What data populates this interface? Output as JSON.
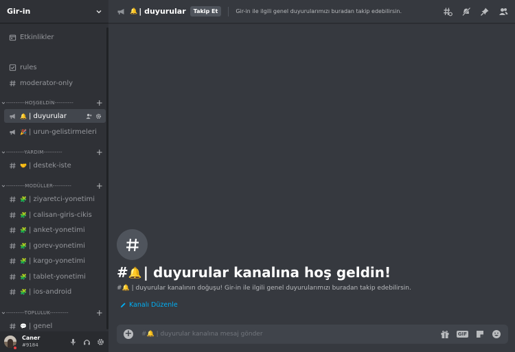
{
  "server": {
    "name": "Gir-in"
  },
  "sidebar": {
    "events_label": "Etkinlikler",
    "items_top": [
      {
        "label": "rules",
        "icon": "rules-icon"
      },
      {
        "label": "moderator-only",
        "icon": "hash-icon"
      }
    ],
    "categories": [
      {
        "label": "----------HOŞGELDİN----------",
        "channels": [
          {
            "emoji": "🔔",
            "label": "| duyurular",
            "icon": "announcement-icon",
            "active": true
          },
          {
            "emoji": "🎉",
            "label": "| urun-gelistirmeleri",
            "icon": "announcement-icon",
            "active": false
          }
        ]
      },
      {
        "label": "----------YARDIM----------",
        "channels": [
          {
            "emoji": "🤝",
            "label": "| destek-iste",
            "icon": "hash-icon"
          }
        ]
      },
      {
        "label": "----------MODÜLLER----------",
        "channels": [
          {
            "emoji": "🧩",
            "label": "| ziyaretci-yonetimi"
          },
          {
            "emoji": "🧩",
            "label": "| calisan-giris-cikis"
          },
          {
            "emoji": "🧩",
            "label": "| anket-yonetimi"
          },
          {
            "emoji": "🧩",
            "label": "| gorev-yonetimi"
          },
          {
            "emoji": "🧩",
            "label": "| kargo-yonetimi"
          },
          {
            "emoji": "🧩",
            "label": "| tablet-yonetimi"
          },
          {
            "emoji": "🧩",
            "label": "| ios-android"
          }
        ]
      },
      {
        "label": "----------TOPLULUK----------",
        "channels": [
          {
            "emoji": "💬",
            "label": "| genel"
          }
        ]
      }
    ]
  },
  "user": {
    "name": "Caner",
    "discriminator": "#9184",
    "status_color": "#ed4245"
  },
  "topbar": {
    "emoji": "🔔",
    "channel": "| duyurular",
    "follow_label": "Takip Et",
    "topic": "Gir-in ile ilgili genel duyurularımızı buradan takip edebilirsin."
  },
  "welcome": {
    "hash": "#",
    "emoji": "🔔",
    "title": "| duyurular kanalına hoş geldin!",
    "desc_prefix": "#🔔",
    "desc": "| duyurular kanalının doğuşu! Gir-in ile ilgili genel duyurularımızı buradan takip edebilirsin.",
    "edit_label": "Kanalı Düzenle"
  },
  "composer": {
    "placeholder": "#🔔 | duyurular kanalına mesaj gönder",
    "gif_label": "GIF"
  },
  "colors": {
    "accent": "#00aff4",
    "bg": "#36393f",
    "sidebar": "#2f3136",
    "active": "#42464d"
  }
}
